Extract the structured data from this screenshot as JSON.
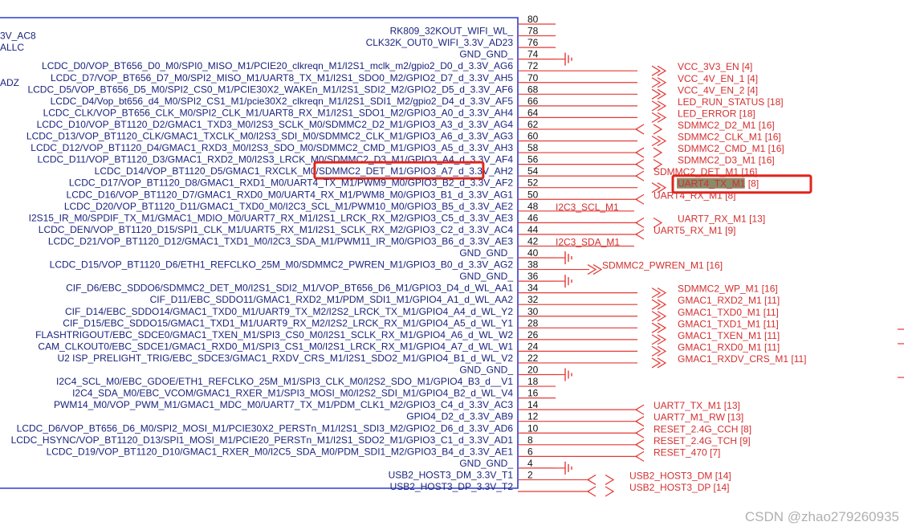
{
  "left_cut_labels": [
    {
      "text": "3V_AC8",
      "row": 1
    },
    {
      "text": "ALLC",
      "row": 2
    },
    {
      "text": "ADZ",
      "row": 5
    }
  ],
  "pins": [
    {
      "num": "80",
      "name": "",
      "net": ""
    },
    {
      "num": "78",
      "name": "RK809_32KOUT_WIFI_WL_",
      "net": ""
    },
    {
      "num": "76",
      "name": "CLK32K_OUT0_WIFI_3.3V_AD23",
      "net": ""
    },
    {
      "num": "74",
      "name": "GND_GND_",
      "net": "",
      "gnd": true
    },
    {
      "num": "72",
      "name": "LCDC_D0/VOP_BT656_D0_M0/SPI0_MISO_M1/PCIE20_clkreqn_M1/I2S1_mclk_m2/gpio2_D0_d_3.3V_AG6",
      "net": "VCC_3V3_EN  [4]",
      "arrow": "out"
    },
    {
      "num": "70",
      "name": "LCDC_D7/VOP_BT656_D7_M0/SPI2_MISO_M1/UART8_TX_M1/I2S1_SDO0_M2/GPIO2_D7_d_3.3V_AH5",
      "net": "VCC_4V_EN_1  [4]",
      "arrow": "out"
    },
    {
      "num": "68",
      "name": "LCDC_D5/VOP_BT656_D5_M0/SPI2_CS0_M1/PCIE30X2_WAKEn_M1/I2S1_SDI2_M2/GPIO2_D5_d_3.3V_AF6",
      "net": "VCC_4V_EN_2  [4]",
      "arrow": "out"
    },
    {
      "num": "66",
      "name": "LCDC_D4/Vop_bt656_d4_M0/SPI2_CS1_M1/pcie30X2_clkreqn_M1/I2S1_SDI1_M2/gpio2_D4_d_3.3V_AF5",
      "net": "LED_RUN_STATUS  [18]",
      "arrow": "out"
    },
    {
      "num": "64",
      "name": "LCDC_CLK/VOP_BT656_CLK_M0/SPI2_CLK_M1/UART8_RX_M1/I2S1_SDO1_M2/GPIO3_A0_d_3.3V_AH4",
      "net": "LED_ERROR  [18]",
      "arrow": "out"
    },
    {
      "num": "62",
      "name": "LCDC_D10/VOP_BT1120_D2/GMAC1_TXD3_M0/I2S3_SCLK_M0/SDMMC2_D2_M1/GPIO3_A3_d_3.3V_AG4",
      "net": "SDMMC2_D2_M1  [16]",
      "arrow": "bi"
    },
    {
      "num": "60",
      "name": "LCDC_D13/VOP_BT1120_CLK/GMAC1_TXCLK_M0/I2S3_SDI_M0/SDMMC2_CLK_M1/GPIO3_A6_d_3.3V_AG3",
      "net": "SDMMC2_CLK_M1  [16]",
      "arrow": "out"
    },
    {
      "num": "58",
      "name": "LCDC_D12/VOP_BT1120_D4/GMAC1_RXD3_M0/I2S3_SDO_M0/SDMMC2_CMD_M1/GPIO3_A5_d_3.3V_AH3",
      "net": "SDMMC2_CMD_M1  [16]",
      "arrow": "bi"
    },
    {
      "num": "56",
      "name": "LCDC_D11/VOP_BT1120_D3/GMAC1_RXD2_M0/I2S3_LRCK_M0/SDMMC2_D3_M1/GPIO3_A4_d_3.3V_AF4",
      "net": "SDMMC2_D3_M1  [16]",
      "arrow": "bi"
    },
    {
      "num": "54",
      "name": "LCDC_D14/VOP_BT1120_D5/GMAC1_RXCLK_M0/SDMMC2_DET_M1/GPIO3_A7_d_3.3V_AH2",
      "net": "SDMMC2_DET_M1  [16]",
      "arrow": "in",
      "highlight": true
    },
    {
      "num": "52",
      "name": "LCDC_D17/VOP_BT1120_D8/GMAC1_RXD1_M0/UART4_TX_M1/PWM9_M0/GPIO3_B2_d_3.3V_AF2",
      "net": "UART4_TX_M1  [8]",
      "arrow": "out"
    },
    {
      "num": "50",
      "name": "LCDC_D16/VOP_BT1120_D7/GMAC1_RXD0_M0/UART4_RX_M1/PWM8_M0/GPIO3_B1_d_3.3V_AG1",
      "net": "UART4_RX_M1  [8]",
      "arrow": "in"
    },
    {
      "num": "48",
      "name": "LCDC_D20/VOP_BT1120_D11/GMAC1_TXD0_M0/I2C3_SCL_M1/PWM10_M0/GPIO3_B5_d_3.3V_AE2",
      "net": "",
      "wire": "I2C3_SCL_M1"
    },
    {
      "num": "46",
      "name": "I2S15_IR_M0/SPDIF_TX_M1/GMAC1_MDIO_M0/UART7_RX_M1/I2S1_LRCK_RX_M2/GPIO3_C5_d_3.3V_AE3",
      "net": "UART7_RX_M1  [13]",
      "arrow": "bi"
    },
    {
      "num": "44",
      "name": "LCDC_DEN/VOP_BT1120_D15/SPI1_CLK_M1/UART5_RX_M1/I2S1_SCLK_RX_M2/GPIO3_C2_d_3.3V_AC4",
      "net": "UART5_RX_M1  [9]",
      "arrow": "in"
    },
    {
      "num": "42",
      "name": "LCDC_D21/VOP_BT1120_D12/GMAC1_TXD1_M0/I2C3_SDA_M1/PWM11_IR_M0/GPIO3_B6_d_3.3V_AE3",
      "net": "",
      "wire": "I2C3_SDA_M1"
    },
    {
      "num": "40",
      "name": "GND_GND_",
      "net": "",
      "gnd": true
    },
    {
      "num": "38",
      "name": "LCDC_D15/VOP_BT1120_D6/ETH1_REFCLKO_25M_M0/SDMMC2_PWREN_M1/GPIO3_B0_d_3.3V_AG2",
      "net": "SDMMC2_PWREN_M1  [16]",
      "arrow": "out2"
    },
    {
      "num": "36",
      "name": "GND_GND_",
      "net": "",
      "gnd": true
    },
    {
      "num": "34",
      "name": "CIF_D6/EBC_SDDO6/SDMMC2_DET_M0/I2S1_SDI2_M1/VOP_BT656_D6_M1/GPIO3_D4_d_WL_AA1",
      "net": "SDMMC2_WP_M1  [16]",
      "arrow": "out"
    },
    {
      "num": "32",
      "name": "CIF_D11/EBC_SDDO11/GMAC1_RXD2_M1/PDM_SDI1_M1/GPIO4_A1_d_WL_AA2",
      "net": "GMAC1_RXD2_M1  [11]",
      "arrow": "out"
    },
    {
      "num": "30",
      "name": "CIF_D14/EBC_SDDO14/GMAC1_TXD0_M1/UART9_TX_M2/I2S2_LRCK_TX_M1/GPIO4_A4_d_WL_Y2",
      "net": "GMAC1_TXD0_M1  [11]",
      "arrow": "out"
    },
    {
      "num": "28",
      "name": "CIF_D15/EBC_SDDO15/GMAC1_TXD1_M1/UART9_RX_M2/I2S2_LRCK_RX_M1/GPIO4_A5_d_WL_Y1",
      "net": "GMAC1_TXD1_M1  [11]",
      "arrow": "out"
    },
    {
      "num": "26",
      "name": "FLASHTRIGOUT/EBC_SDCE0/GMAC1_TXEN_M1/SPI3_CS0_M0/I2S1_SCLK_RX_M1/GPIO4_A6_d_WL_W2",
      "net": "GMAC1_TXEN_M1  [11]",
      "arrow": "out"
    },
    {
      "num": "24",
      "name": "CAM_CLKOUT0/EBC_SDCE1/GMAC1_RXD0_M1/SPI3_CS1_M0/I2S1_LRCK_RX_M1/GPIO4_A7_d_WL_W1",
      "net": "GMAC1_RXD0_M1  [11]",
      "arrow": "out"
    },
    {
      "num": "22",
      "name": "U2    ISP_PRELIGHT_TRIG/EBC_SDCE3/GMAC1_RXDV_CRS_M1/I2S1_SDO2_M1/GPIO4_B1_d_WL_V2",
      "net": "GMAC1_RXDV_CRS_M1  [11]",
      "arrow": "out"
    },
    {
      "num": "20",
      "name": "GND_GND_",
      "net": "",
      "gnd": true
    },
    {
      "num": "18",
      "name": "I2C4_SCL_M0/EBC_GDOE/ETH1_REFCLKO_25M_M1/SPI3_CLK_M0/I2S2_SDO_M1/GPIO4_B3_d__V1",
      "net": ""
    },
    {
      "num": "16",
      "name": "I2C4_SDA_M0/EBC_VCOM/GMAC1_RXER_M1/SPI3_MOSI_M0/I2S2_SDI_M1/GPIO4_B2_d_WL_V4",
      "net": ""
    },
    {
      "num": "14",
      "name": "PWM14_M0/VOP_PWM_M1/GMAC1_MDC_M0/UART7_TX_M1/PDM_CLK1_M2/GPIO3_C4_d_3.3V_AC3",
      "net": "UART7_TX_M1  [13]",
      "arrow": "in"
    },
    {
      "num": "12",
      "name": "GPIO4_D2_d_3.3V_AB9",
      "net": "UART7_M1_RW  [13]",
      "arrow": "in"
    },
    {
      "num": "10",
      "name": "LCDC_D6/VOP_BT656_D6_M0/SPI2_MOSI_M1/PCIE30X2_PERSTn_M1/I2S1_SDI3_M2/GPIO2_D6_d_3.3V_AD6",
      "net": "RESET_2.4G_CCH  [8]",
      "arrow": "in"
    },
    {
      "num": "8",
      "name": "LCDC_HSYNC/VOP_BT1120_D13/SPI1_MOSI_M1/PCIE20_PERSTn_M1/I2S1_SDO2_M1/GPIO3_C1_d_3.3V_AD1",
      "net": "RESET_2.4G_TCH  [9]",
      "arrow": "in"
    },
    {
      "num": "6",
      "name": "LCDC_D19/VOP_BT1120_D10/GMAC1_RXER_M0/I2C5_SDA_M0/PDM_SDI1_M2/GPIO3_B4_d_3.3V_AE1",
      "net": "RESET_470  [7]",
      "arrow": "in"
    },
    {
      "num": "4",
      "name": "GND_GND_",
      "net": "",
      "gnd": true
    },
    {
      "num": "2",
      "name": "USB2_HOST3_DM_3.3V_T1",
      "net": "USB2_HOST3_DM  [14]",
      "arrow": "bi2"
    },
    {
      "num": "",
      "name": "USB2_HOST3_DP_3.3V_T2",
      "net": "USB2_HOST3_DP  [14]",
      "arrow": "bi2"
    }
  ],
  "pin_name_highlights": [
    {
      "row": 14,
      "text": "SDMMC2_DET"
    },
    {
      "row": 24,
      "text": "SDMMC2_DET"
    }
  ],
  "net_highlight": {
    "row": 14,
    "text": "SDMMC2_DET"
  },
  "watermark": "CSDN @zhao279260935",
  "colors": {
    "box": "#2f3fd0",
    "wire": "#e53935",
    "text": "#1a237e",
    "net": "#d32f2f",
    "highlight": "#f9c33a",
    "red_frame": "#e0241b",
    "net_highlight": "#8b8b6a"
  }
}
